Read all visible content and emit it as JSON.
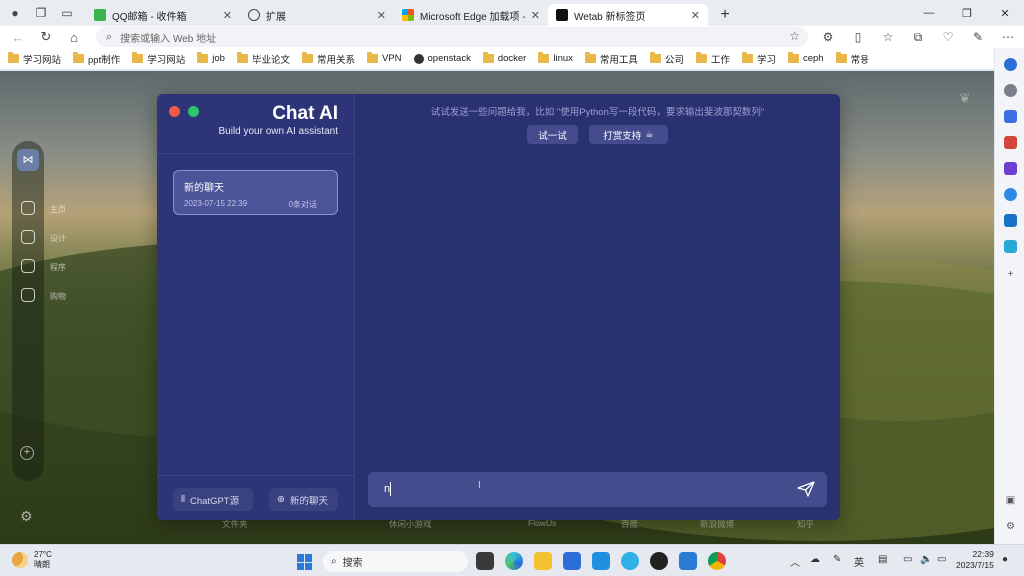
{
  "browser": {
    "tabs": [
      {
        "title": "QQ邮箱 - 收件箱",
        "active": false
      },
      {
        "title": "扩展",
        "active": false
      },
      {
        "title": "Microsoft Edge 加载项 - wetab",
        "active": false
      },
      {
        "title": "Wetab 新标签页",
        "active": true
      }
    ],
    "address_placeholder": "搜索或输入 Web 地址"
  },
  "bookmarks": [
    "学习网站",
    "ppt制作",
    "学习网站",
    "job",
    "毕业论文",
    "常用关系",
    "VPN",
    "openstack",
    "docker",
    "linux",
    "常用工具",
    "公司",
    "工作",
    "学习",
    "ceph",
    "常용"
  ],
  "wetab": {
    "dock_labels": [
      "主页",
      "设计",
      "程序",
      "购物"
    ],
    "bottom_links": [
      "文件夹",
      "休闲小游戏",
      "FlowUs",
      "百度",
      "新浪微博",
      "知乎"
    ]
  },
  "chat": {
    "brand_title": "Chat AI",
    "brand_subtitle": "Build your own AI assistant",
    "session": {
      "title": "新的聊天",
      "time": "2023-07-15 22:39",
      "count": "0条对话"
    },
    "hint": "试试发送一些问题给我，比如 \"使用Python写一段代码，要求输出斐波那契数列\"",
    "try_button": "试一试",
    "support_button": "打赏支持",
    "footer_source": "ChatGPT源",
    "footer_new": "新的聊天",
    "input_value": "n"
  },
  "taskbar": {
    "temperature": "27°C",
    "weather": "晴朗",
    "search": "搜索",
    "time": "22:39",
    "date": "2023/7/15",
    "ime": "英"
  }
}
